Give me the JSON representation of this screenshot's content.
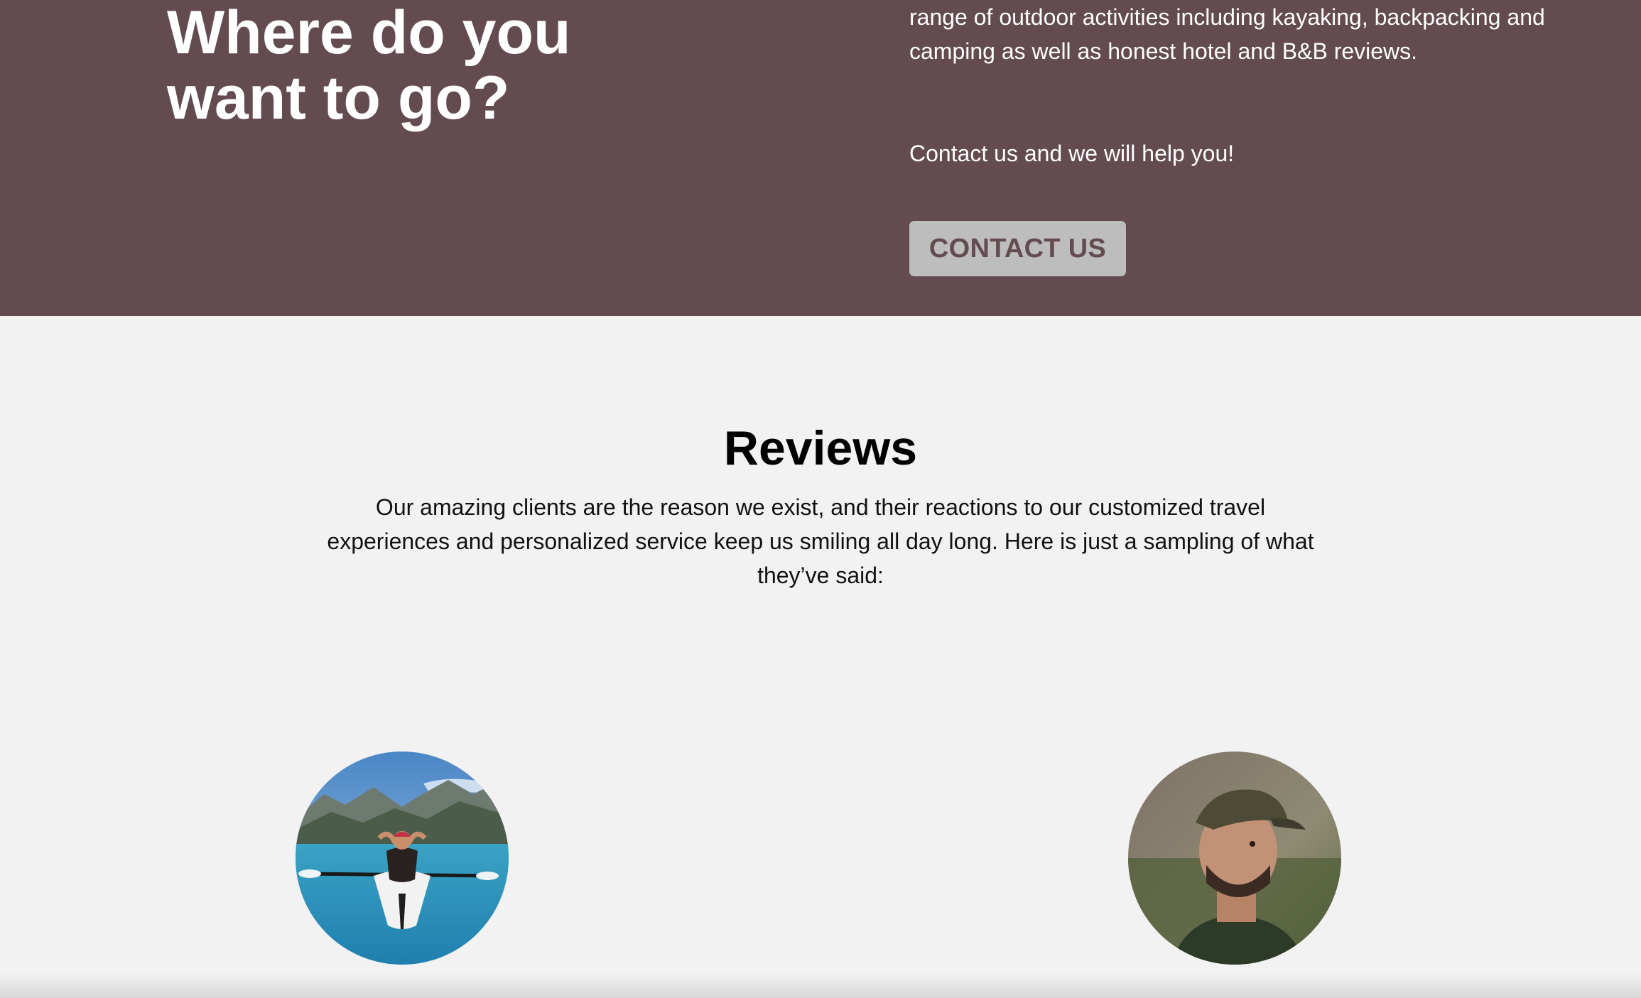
{
  "hero": {
    "title": "Where do you want to go?",
    "body": "range of outdoor activities including kayaking, backpacking and camping as well as honest hotel and B&B reviews.",
    "contact_text": "Contact us and we will help you!",
    "contact_button_label": "CONTACT US"
  },
  "reviews": {
    "title": "Reviews",
    "intro": "Our amazing clients are the reason we exist, and their reactions to our customized travel experiences and personalized service keep us smiling all day long. Here is just a sampling of what they’ve said:"
  },
  "colors": {
    "hero_background": "#634b50",
    "page_background": "#f2f2f2",
    "button_background": "#bdbdbd",
    "button_text": "#634b50"
  },
  "icons": {
    "left_avatar": "kayaker-photo",
    "right_avatar": "hiker-portrait-photo"
  }
}
